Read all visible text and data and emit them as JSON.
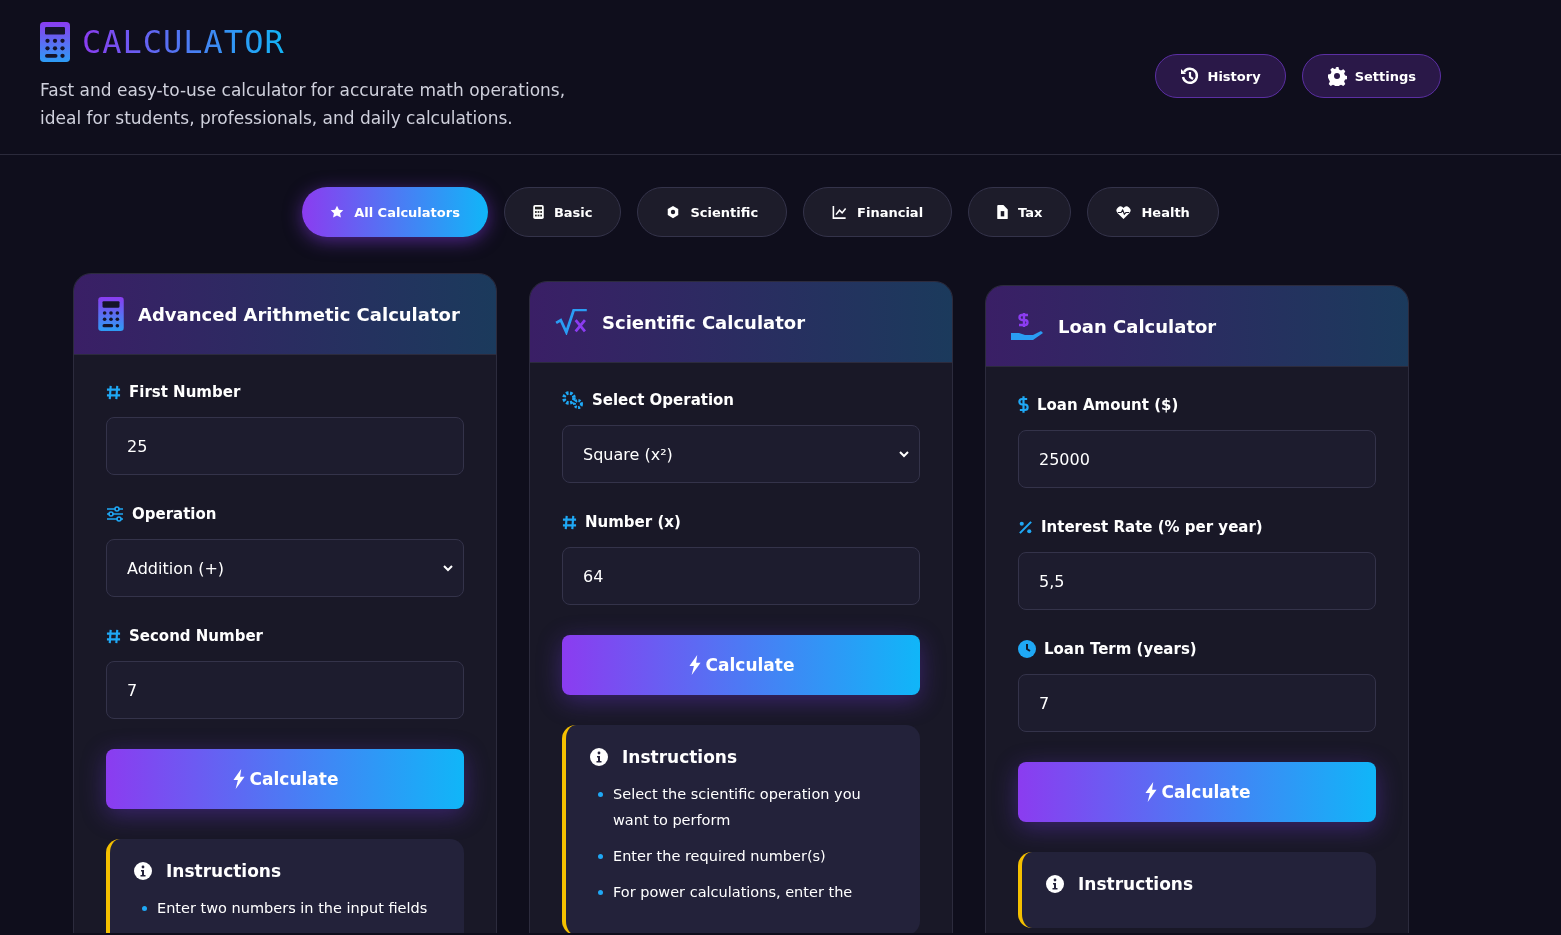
{
  "header": {
    "title": "CALCULATOR",
    "subtitle": "Fast and easy-to-use calculator for accurate math operations, ideal for students, professionals, and daily calculations.",
    "actions": [
      "History",
      "Settings"
    ]
  },
  "tabs": [
    {
      "label": "All Calculators",
      "selected": true
    },
    {
      "label": "Basic",
      "selected": false
    },
    {
      "label": "Scientific",
      "selected": false
    },
    {
      "label": "Financial",
      "selected": false
    },
    {
      "label": "Tax",
      "selected": false
    },
    {
      "label": "Health",
      "selected": false
    }
  ],
  "cards": [
    {
      "title": "Advanced Arithmetic Calculator",
      "fields": [
        {
          "kind": "input",
          "label": "First Number",
          "value": "25"
        },
        {
          "kind": "select",
          "label": "Operation",
          "value": "Addition (+)"
        },
        {
          "kind": "input",
          "label": "Second Number",
          "value": "7"
        }
      ],
      "button": "Calculate",
      "instructions": {
        "title": "Instructions",
        "items": [
          "Enter two numbers in the input fields"
        ]
      }
    },
    {
      "title": "Scientific Calculator",
      "fields": [
        {
          "kind": "select",
          "label": "Select Operation",
          "value": "Square (x²)"
        },
        {
          "kind": "input",
          "label": "Number (x)",
          "value": "64"
        }
      ],
      "button": "Calculate",
      "instructions": {
        "title": "Instructions",
        "items": [
          "Select the scientific operation you want to perform",
          "Enter the required number(s)",
          "For power calculations, enter the"
        ]
      }
    },
    {
      "title": "Loan Calculator",
      "fields": [
        {
          "kind": "input",
          "label": "Loan Amount ($)",
          "value": "25000"
        },
        {
          "kind": "input",
          "label": "Interest Rate (% per year)",
          "value": "5,5"
        },
        {
          "kind": "input",
          "label": "Loan Term (years)",
          "value": "7"
        }
      ],
      "button": "Calculate",
      "instructions": {
        "title": "Instructions"
      }
    }
  ]
}
